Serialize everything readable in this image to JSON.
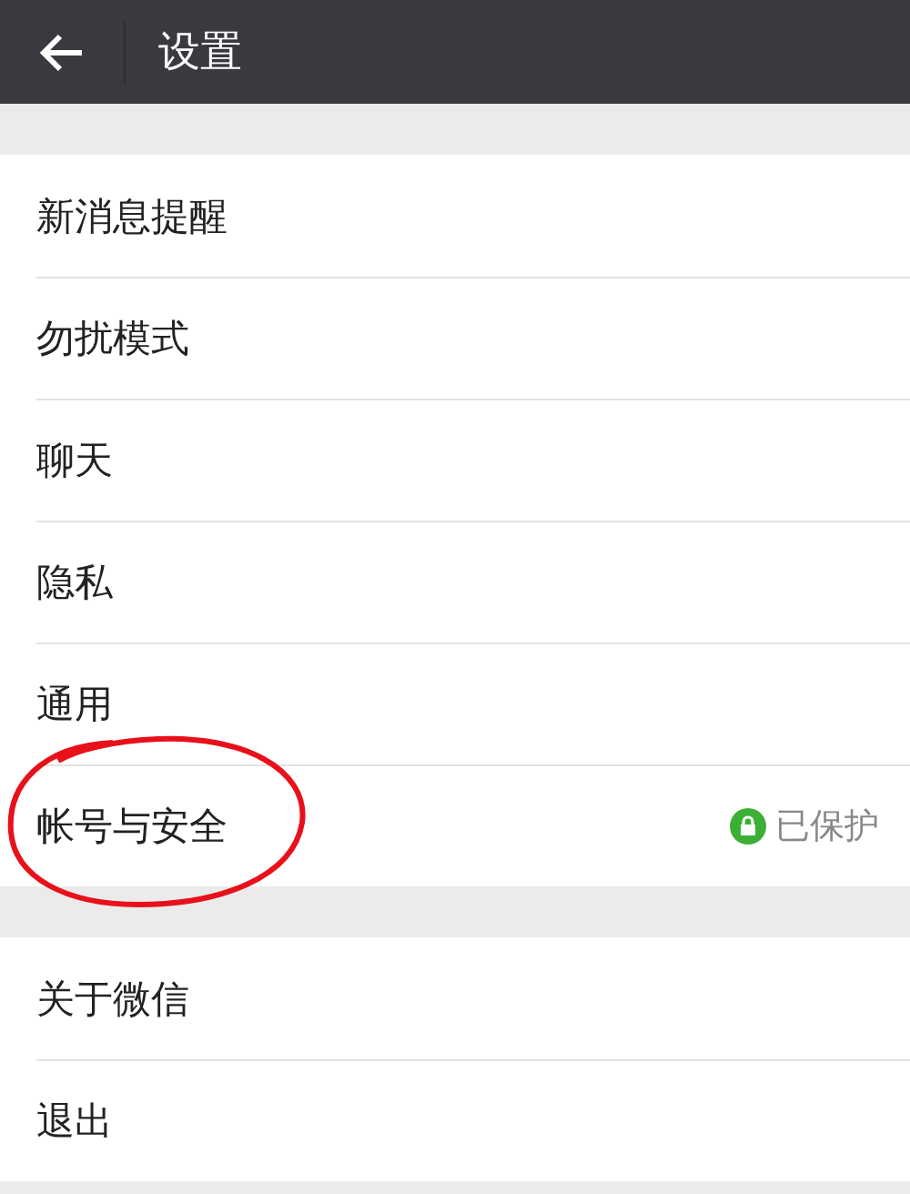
{
  "header": {
    "title": "设置"
  },
  "groups": [
    {
      "items": [
        {
          "label": "新消息提醒",
          "circled": false
        },
        {
          "label": "勿扰模式",
          "circled": false
        },
        {
          "label": "聊天",
          "circled": false
        },
        {
          "label": "隐私",
          "circled": false
        },
        {
          "label": "通用",
          "circled": false
        },
        {
          "label": "帐号与安全",
          "circled": true,
          "status": "已保护"
        }
      ]
    },
    {
      "items": [
        {
          "label": "关于微信",
          "circled": false
        },
        {
          "label": "退出",
          "circled": false
        }
      ]
    }
  ]
}
